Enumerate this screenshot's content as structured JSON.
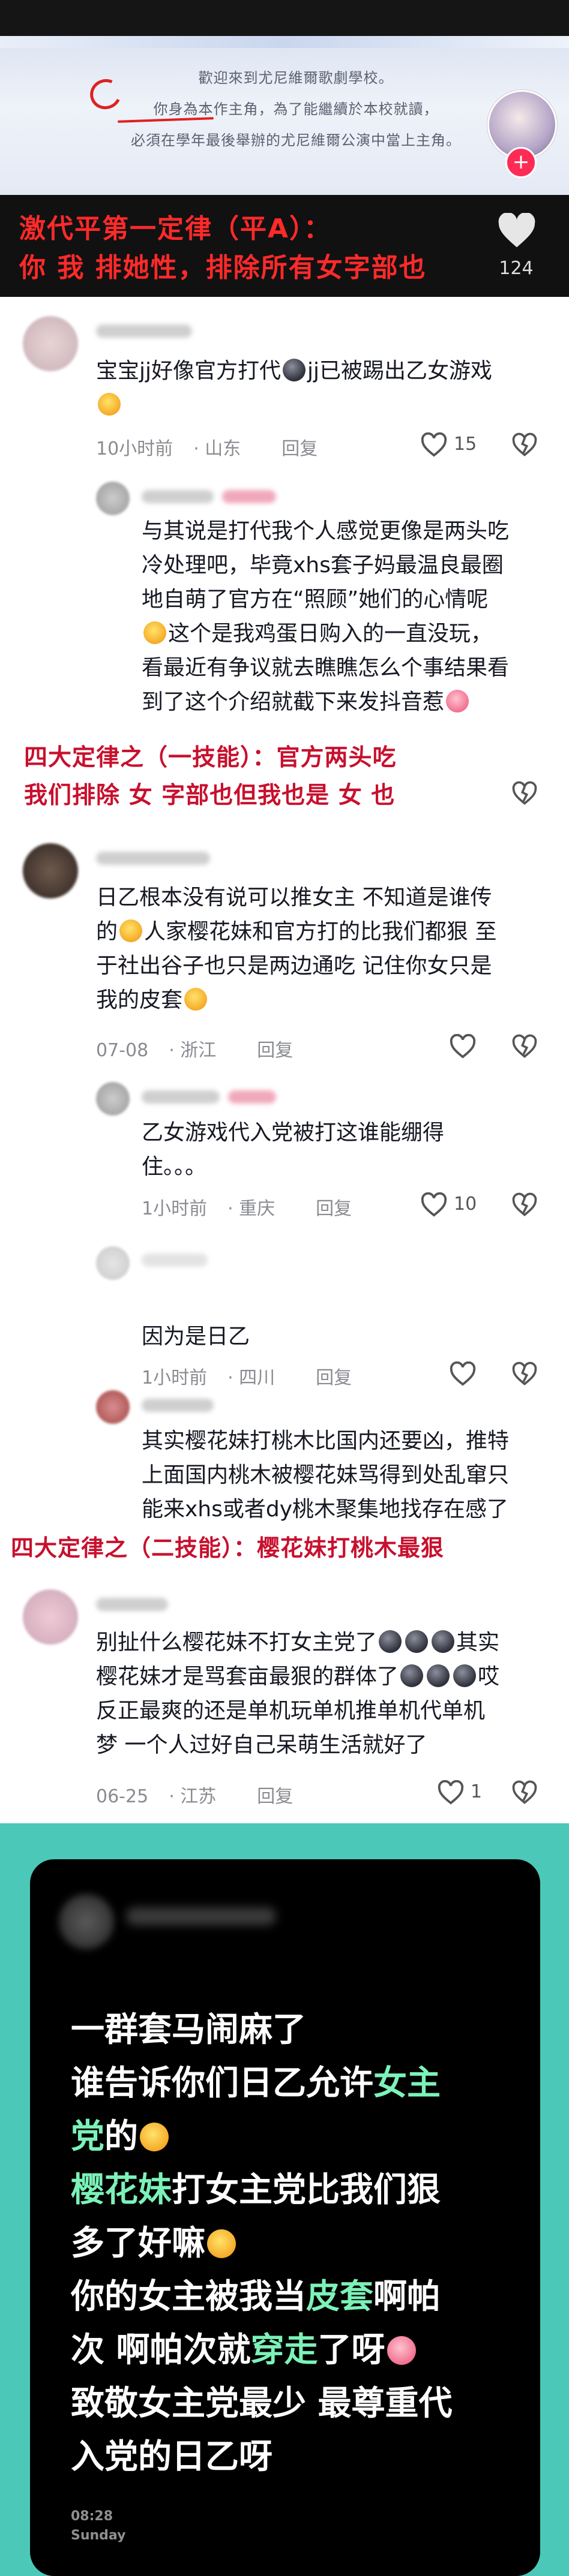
{
  "video": {
    "game_lines": [
      "歡迎來到尤尼維爾歌劇學校。",
      "你身為本作主角，為了能繼續於本校就讀，",
      "必須在學年最後舉辦的尤尼維爾公演中當上主角。"
    ],
    "overlay_line1": "激代平第一定律（平A）：",
    "overlay_line2": "你 我 排她性，排除所有女字部也",
    "like_count": "124"
  },
  "comments": [
    {
      "text_lines": [
        "宝宝jj好像官方打代",
        "jj已被踢出乙女游戏"
      ],
      "time": "10小时前",
      "location": "山东",
      "reply_label": "回复",
      "likes": "15"
    },
    {
      "text_lines": [
        "与其说是打代我个人感觉更像是两头吃",
        "冷处理吧，毕竟xhs套子妈最温良最圈",
        "地自萌了官方在“照顾”她们的心情呢",
        "这个是我鸡蛋日购入的一直没玩，",
        "看最近有争议就去瞧瞧怎么个事结果看",
        "到了这个介绍就截下来发抖音惹"
      ]
    },
    {
      "overlay_line1": "四大定律之（一技能）：官方两头吃",
      "overlay_line2": "我们排除 女 字部也但我也是 女 也"
    },
    {
      "text_lines": [
        "日乙根本没有说可以推女主 不知道是谁传",
        "的",
        "人家樱花妹和官方打的比我们都狠 至",
        "于社出谷子也只是两边通吃 记住你女只是",
        "我的皮套"
      ],
      "time": "07-08",
      "location": "浙江",
      "reply_label": "回复"
    },
    {
      "text_lines": [
        "乙女游戏代入党被打这谁能绷得",
        "住。。。"
      ],
      "time": "1小时前",
      "location": "重庆",
      "reply_label": "回复",
      "likes": "10"
    },
    {
      "text_lines": [
        "因为是日乙"
      ],
      "time": "1小时前",
      "location": "四川",
      "reply_label": "回复"
    },
    {
      "text_lines": [
        "其实樱花妹打桃木比国内还要凶，推特",
        "上面国内桃木被樱花妹骂得到处乱窜只",
        "能来xhs或者dy桃木聚集地找存在感了"
      ],
      "overlay": "四大定律之（二技能）：樱花妹打桃木最狠"
    },
    {
      "text_lines": [
        "别扯什么樱花妹不打女主党了",
        "其实",
        "樱花妹才是骂套亩最狠的群体了",
        "哎",
        "反正最爽的还是单机玩单机推单机代单机",
        "梦 一个人过好自己呆萌生活就好了"
      ],
      "time": "06-25",
      "location": "江苏",
      "reply_label": "回复",
      "likes": "1"
    }
  ],
  "screenshot": {
    "lines": [
      [
        {
          "t": "一群套马闹麻了",
          "g": false
        }
      ],
      [
        {
          "t": "谁告诉你们日乙允许",
          "g": false
        },
        {
          "t": "女主",
          "g": true
        }
      ],
      [
        {
          "t": "党",
          "g": true
        },
        {
          "t": "的",
          "g": false
        }
      ],
      [
        {
          "t": "樱花妹",
          "g": true
        },
        {
          "t": "打女主党比我们狠",
          "g": false
        }
      ],
      [
        {
          "t": "多了好嘛",
          "g": false
        }
      ],
      [
        {
          "t": "你的女主被我当",
          "g": false
        },
        {
          "t": "皮套",
          "g": true
        },
        {
          "t": "啊帕",
          "g": false
        }
      ],
      [
        {
          "t": "次 啊帕次就",
          "g": false
        },
        {
          "t": "穿走",
          "g": true
        },
        {
          "t": "了呀",
          "g": false
        }
      ],
      [
        {
          "t": "致敬女主党最少 最尊重代",
          "g": false
        }
      ],
      [
        {
          "t": "入党的日乙呀",
          "g": false
        }
      ]
    ],
    "time": "08:28",
    "day": "Sunday"
  },
  "colors": {
    "overlay_red": "#c8102e",
    "teal": "#4cc8b8",
    "green_text": "#7cf2b8",
    "like_red": "#fe2c55"
  }
}
